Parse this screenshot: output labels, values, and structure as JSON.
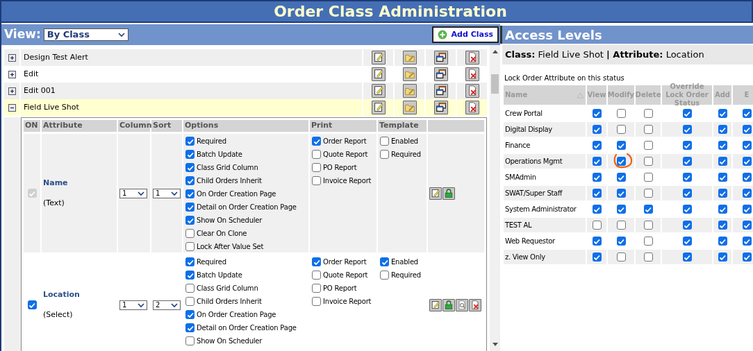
{
  "title": "Order Class Administration",
  "view": {
    "label": "View:",
    "value": "By Class"
  },
  "add_button": "Add Class",
  "classes": [
    {
      "name": "Design Test Alert",
      "expanded": false
    },
    {
      "name": "Edit",
      "expanded": false
    },
    {
      "name": "Edit 001",
      "expanded": false
    },
    {
      "name": "Field Live Shot",
      "expanded": true
    }
  ],
  "attribute_columns": [
    "ON",
    "Attribute",
    "Column",
    "Sort",
    "Options",
    "Print",
    "Template"
  ],
  "attributes": [
    {
      "on": true,
      "disabled": true,
      "name": "Name",
      "type": "(Text)",
      "column_select": "1",
      "sort_select": "1",
      "options": [
        {
          "label": "Required",
          "checked": true
        },
        {
          "label": "Batch Update",
          "checked": true
        },
        {
          "label": "Class Grid Column",
          "checked": true
        },
        {
          "label": "Child Orders Inherit",
          "checked": true
        },
        {
          "label": "On Order Creation Page",
          "checked": true
        },
        {
          "label": "Detail on Order Creation Page",
          "checked": true
        },
        {
          "label": "Show On Scheduler",
          "checked": true
        },
        {
          "label": "Clear On Clone",
          "checked": false
        },
        {
          "label": "Lock After Value Set",
          "checked": false
        }
      ],
      "print": [
        {
          "label": "Order Report",
          "checked": true
        },
        {
          "label": "Quote Report",
          "checked": false
        },
        {
          "label": "PO Report",
          "checked": false
        },
        {
          "label": "Invoice Report",
          "checked": false
        }
      ],
      "template": [
        {
          "label": "Enabled",
          "checked": false
        },
        {
          "label": "Required",
          "checked": false
        }
      ],
      "actions": [
        {
          "kind": "edit"
        },
        {
          "kind": "lock"
        }
      ]
    },
    {
      "on": true,
      "disabled": false,
      "name": "Location",
      "type": "(Select)",
      "column_select": "1",
      "sort_select": "2",
      "options": [
        {
          "label": "Required",
          "checked": true
        },
        {
          "label": "Batch Update",
          "checked": true
        },
        {
          "label": "Class Grid Column",
          "checked": false
        },
        {
          "label": "Child Orders Inherit",
          "checked": false
        },
        {
          "label": "On Order Creation Page",
          "checked": true
        },
        {
          "label": "Detail on Order Creation Page",
          "checked": true
        },
        {
          "label": "Show On Scheduler",
          "checked": false
        }
      ],
      "print": [
        {
          "label": "Order Report",
          "checked": true
        },
        {
          "label": "Quote Report",
          "checked": false
        },
        {
          "label": "PO Report",
          "checked": false
        },
        {
          "label": "Invoice Report",
          "checked": false
        }
      ],
      "template": [
        {
          "label": "Enabled",
          "checked": true
        },
        {
          "label": "Required",
          "checked": false
        }
      ],
      "actions": [
        {
          "kind": "edit"
        },
        {
          "kind": "lock"
        },
        {
          "kind": "preview"
        },
        {
          "kind": "delete"
        }
      ]
    }
  ],
  "access": {
    "title": "Access Levels",
    "class_label": "Class:",
    "class_value": "Field Live Shot",
    "separator": "|",
    "attribute_label": "Attribute:",
    "attribute_value": "Location",
    "lock_note": "Lock Order Attribute on this status",
    "columns": [
      "Name",
      "View",
      "Modify",
      "Delete",
      "Override Lock Order Status",
      "Add",
      "E"
    ],
    "rows": [
      {
        "name": "Crew Portal",
        "cells": [
          {
            "checked": true
          },
          {
            "checked": false
          },
          {
            "checked": false
          },
          {
            "checked": true
          },
          {
            "checked": true
          },
          {
            "checked": true
          }
        ]
      },
      {
        "name": "Digital Display",
        "cells": [
          {
            "checked": true
          },
          {
            "checked": false
          },
          {
            "checked": false
          },
          {
            "checked": true
          },
          {
            "checked": true
          },
          {
            "checked": true
          }
        ]
      },
      {
        "name": "Finance",
        "cells": [
          {
            "checked": true
          },
          {
            "checked": true
          },
          {
            "checked": false
          },
          {
            "checked": true
          },
          {
            "checked": true
          },
          {
            "checked": true
          }
        ]
      },
      {
        "name": "Operations Mgmt",
        "cells": [
          {
            "checked": true
          },
          {
            "checked": true,
            "circled": true
          },
          {
            "checked": false
          },
          {
            "checked": true
          },
          {
            "checked": true
          },
          {
            "checked": true
          }
        ]
      },
      {
        "name": "SMAdmin",
        "cells": [
          {
            "checked": true
          },
          {
            "checked": true
          },
          {
            "checked": false
          },
          {
            "checked": true
          },
          {
            "checked": true
          },
          {
            "checked": true
          }
        ]
      },
      {
        "name": "SWAT/Super Staff",
        "cells": [
          {
            "checked": true
          },
          {
            "checked": true
          },
          {
            "checked": false
          },
          {
            "checked": true
          },
          {
            "checked": true
          },
          {
            "checked": true
          }
        ]
      },
      {
        "name": "System Administrator",
        "cells": [
          {
            "checked": true
          },
          {
            "checked": true
          },
          {
            "checked": true
          },
          {
            "checked": true
          },
          {
            "checked": true
          },
          {
            "checked": true
          }
        ]
      },
      {
        "name": "TEST AL",
        "cells": [
          {
            "checked": false
          },
          {
            "checked": false
          },
          {
            "checked": false
          },
          {
            "checked": true
          },
          {
            "checked": true
          },
          {
            "checked": true
          }
        ]
      },
      {
        "name": "Web Requestor",
        "cells": [
          {
            "checked": true
          },
          {
            "checked": true
          },
          {
            "checked": false
          },
          {
            "checked": true
          },
          {
            "checked": true
          },
          {
            "checked": true
          }
        ]
      },
      {
        "name": "z. View Only",
        "cells": [
          {
            "checked": true
          },
          {
            "checked": false
          },
          {
            "checked": false
          },
          {
            "checked": true
          },
          {
            "checked": true
          },
          {
            "checked": true
          }
        ]
      }
    ]
  }
}
